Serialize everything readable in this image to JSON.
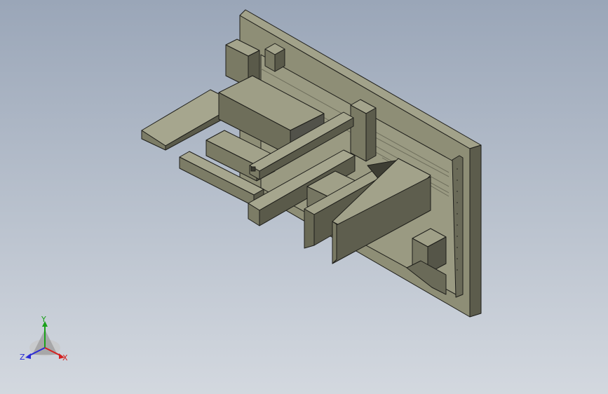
{
  "viewport": {
    "background_top": "#9aa6b8",
    "background_bottom": "#d3d8df"
  },
  "model": {
    "face_colors": {
      "light": "#a0a08a",
      "mid": "#86866e",
      "dark": "#5c5c4c",
      "darkest": "#3c3c32",
      "edge": "#1e1e1a"
    }
  },
  "triad": {
    "x_label": "X",
    "y_label": "Y",
    "z_label": "Z",
    "x_color": "#d42020",
    "y_color": "#1aa11a",
    "z_color": "#2b2bd6"
  }
}
